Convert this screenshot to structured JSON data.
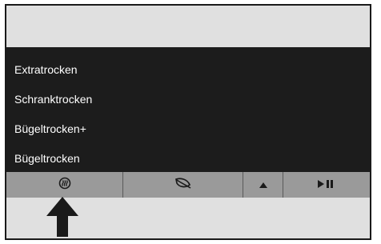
{
  "menu": {
    "items": [
      {
        "label": "Extratrocken"
      },
      {
        "label": "Schranktrocken"
      },
      {
        "label": "Bügeltrocken+"
      },
      {
        "label": "Bügeltrocken"
      }
    ]
  },
  "button_bar": {
    "buttons": [
      {
        "icon": "steam-refresh-icon"
      },
      {
        "icon": "leaf-eco-icon"
      },
      {
        "icon": "triangle-up-icon"
      },
      {
        "icon": "play-pause-icon"
      }
    ]
  },
  "colors": {
    "panel_background": "#1c1c1c",
    "panel_text": "#ffffff",
    "button_bar": "#9a9a9a",
    "screen_background": "#e0e0e0",
    "icon": "#1a1a1a"
  }
}
